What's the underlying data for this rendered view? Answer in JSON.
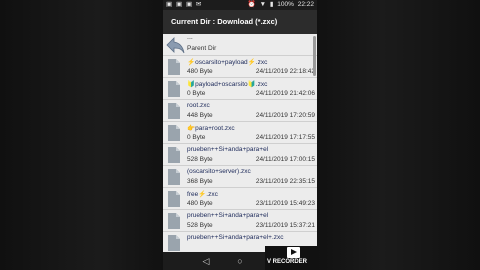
{
  "status_bar": {
    "left_icons": [
      "▣",
      "▣",
      "▣",
      "✉"
    ],
    "right_icons": [
      "⏰",
      "▼",
      "▮"
    ],
    "battery": "100%",
    "time": "22:22"
  },
  "title": "Current Dir : Download (*.zxc)",
  "parent": {
    "dots": "...",
    "label": "Parent Dir"
  },
  "files": [
    {
      "name": "⚡oscarsito+payload⚡.zxc",
      "size": "480 Byte",
      "date": "24/11/2019 22:18:42"
    },
    {
      "name": "🔰payload+oscarsito🔰.zxc",
      "size": "0 Byte",
      "date": "24/11/2019 21:42:06"
    },
    {
      "name": "root.zxc",
      "size": "448 Byte",
      "date": "24/11/2019 17:20:59"
    },
    {
      "name": "👉para+root.zxc",
      "size": "0 Byte",
      "date": "24/11/2019 17:17:55"
    },
    {
      "name": "prueben++Si+anda+para+el",
      "size": "528 Byte",
      "date": "24/11/2019 17:00:15"
    },
    {
      "name": "(oscarsito+server).zxc",
      "size": "368 Byte",
      "date": "23/11/2019 22:35:15"
    },
    {
      "name": "free⚡.zxc",
      "size": "480 Byte",
      "date": "23/11/2019 15:49:23"
    },
    {
      "name": "prueben++Si+anda+para+el",
      "size": "528 Byte",
      "date": "23/11/2019 15:37:21"
    },
    {
      "name": "prueben++Si+anda+para+el+.zxc",
      "size": "",
      "date": ""
    }
  ],
  "recorder": {
    "label": "V RECORDER"
  },
  "nav": {
    "back": "◁",
    "home": "○",
    "recent": "□"
  }
}
